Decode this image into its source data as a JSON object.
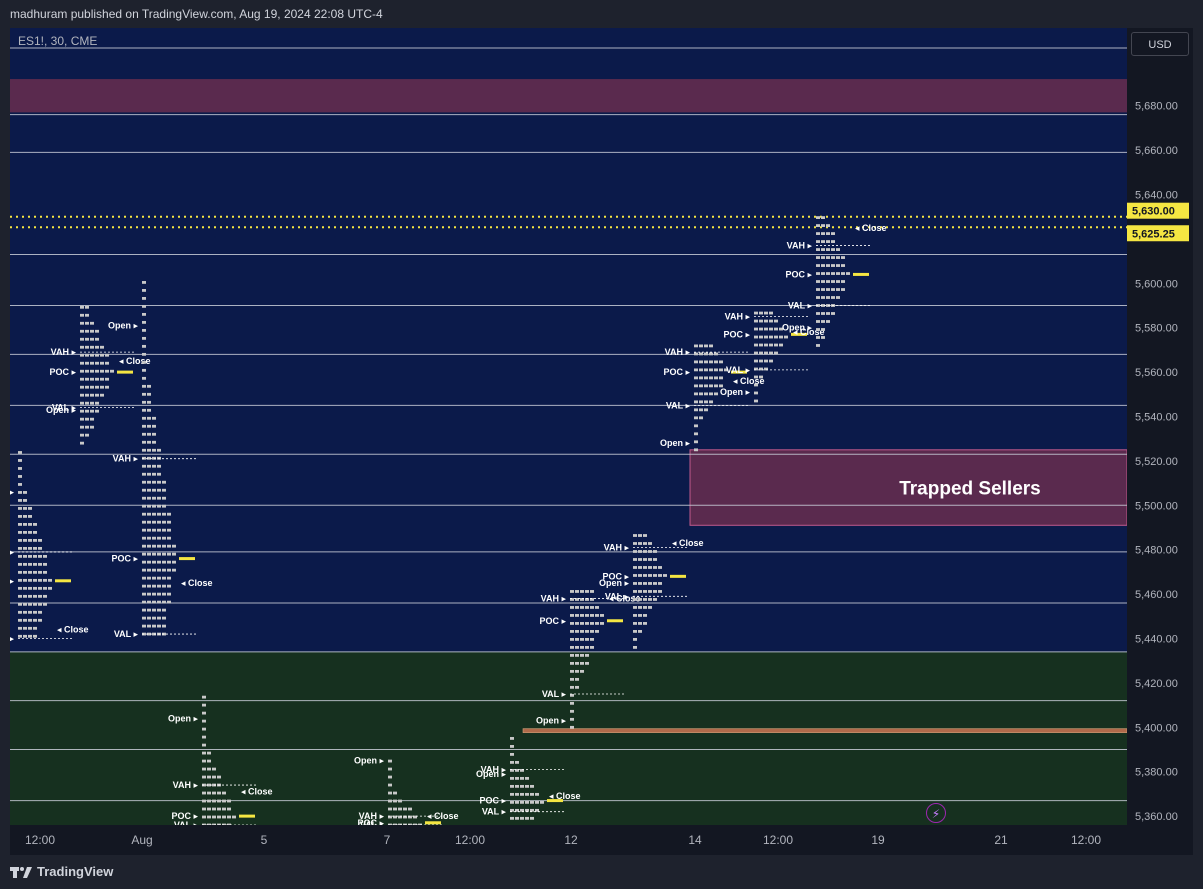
{
  "attribution": "madhuram published on TradingView.com, Aug 19, 2024 22:08 UTC-4",
  "brand": "TradingView",
  "symbol": "ES1!, 30, CME",
  "currency_button": "USD",
  "colors": {
    "background": "#0b1a4a",
    "resistance_zone": "#5a2a4e",
    "support_zone": "#16301f",
    "dotted_level": "#f5e642",
    "poc_marker": "#f5e642",
    "level_line": "#c9cdd8",
    "profile_block": "#c8c8c8"
  },
  "chart_data": {
    "type": "market-profile",
    "ylim": [
      5356,
      5715
    ],
    "y_ticks": [
      5360,
      5380,
      5400,
      5420,
      5440,
      5460,
      5480,
      5500,
      5520,
      5540,
      5560,
      5580,
      5600,
      5620,
      5640,
      5660,
      5680
    ],
    "y_tick_labels": [
      "5,360.00",
      "5,380.00",
      "5,400.00",
      "5,420.00",
      "5,440.00",
      "5,460.00",
      "5,480.00",
      "5,500.00",
      "5,520.00",
      "5,540.00",
      "5,560.00",
      "5,580.00",
      "5,600.00",
      "",
      "5,640.00",
      "5,660.00",
      "5,680.00"
    ],
    "x_ticks": [
      "12:00",
      "Aug",
      "5",
      "7",
      "12:00",
      "12",
      "14",
      "12:00",
      "19",
      "21",
      "12:00"
    ],
    "price_tags": [
      {
        "value": 5630.0,
        "label": "5,630.00"
      },
      {
        "value": 5625.25,
        "label": "5,625.25"
      }
    ],
    "dotted_levels": [
      5630.0,
      5625.25
    ],
    "horizontal_levels": [
      5706,
      5676,
      5659,
      5613,
      5590,
      5568,
      5545,
      5523,
      5500,
      5479,
      5456,
      5434,
      5412,
      5390,
      5367
    ],
    "zones": [
      {
        "name": "resistance",
        "from": 5677,
        "to": 5692
      },
      {
        "name": "support",
        "from": 5356,
        "to": 5434
      }
    ],
    "box": {
      "label": "Trapped Sellers",
      "from": 5491,
      "to": 5525
    },
    "thin_band": {
      "value": 5398.5
    },
    "profiles": [
      {
        "day": 1,
        "low": 5441,
        "high": 5526,
        "poc": 5466,
        "vah": 5479,
        "val": 5440,
        "open": 5506,
        "close": 5444
      },
      {
        "day": 2,
        "low": 5528,
        "high": 5590,
        "poc": 5560,
        "vah": 5569,
        "val": 5544,
        "open": 5543,
        "close": 5565
      },
      {
        "day": 3,
        "low": 5442,
        "high": 5603,
        "poc": 5476,
        "vah": 5521,
        "val": 5442,
        "open": 5581,
        "close": 5465
      },
      {
        "day": 4,
        "low": 5356,
        "high": 5417,
        "poc": 5360,
        "vah": 5374,
        "val": 5356,
        "open": 5404,
        "close": 5371
      },
      {
        "day": 5,
        "low": 5356,
        "high": 5385,
        "poc": 5357,
        "vah": 5360,
        "val": 5356,
        "open": 5385,
        "close": 5360
      },
      {
        "day": 6,
        "low": 5359,
        "high": 5396,
        "poc": 5367,
        "vah": 5381,
        "val": 5362,
        "open": 5379,
        "close": 5369
      },
      {
        "day": 7,
        "low": 5400,
        "high": 5462,
        "poc": 5448,
        "vah": 5458,
        "val": 5415,
        "open": 5403,
        "close": 5458
      },
      {
        "day": 8,
        "low": 5436,
        "high": 5489,
        "poc": 5468,
        "vah": 5481,
        "val": 5459,
        "open": 5465,
        "close": 5483
      },
      {
        "day": 9,
        "low": 5525,
        "high": 5572,
        "poc": 5560,
        "vah": 5569,
        "val": 5545,
        "open": 5528,
        "close": 5556
      },
      {
        "day": 10,
        "low": 5547,
        "high": 5587,
        "poc": 5577,
        "vah": 5585,
        "val": 5561,
        "open": 5551,
        "close": 5578
      },
      {
        "day": 11,
        "low": 5572,
        "high": 5632,
        "poc": 5604,
        "vah": 5617,
        "val": 5590,
        "open": 5580,
        "close": 5625
      }
    ]
  },
  "annotations": [
    {
      "text": "Trapped Sellers"
    },
    {
      "text": "VAH"
    },
    {
      "text": "POC"
    },
    {
      "text": "VAL"
    },
    {
      "text": "Open"
    },
    {
      "text": "Close"
    }
  ]
}
